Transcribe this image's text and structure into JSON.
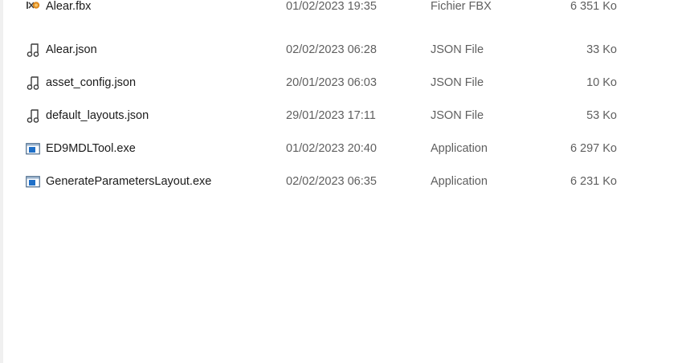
{
  "files": [
    {
      "name": "Alear.fbx",
      "date": "01/02/2023 19:35",
      "type": "Fichier FBX",
      "size": "6 351 Ko",
      "icon": "fbx-file-icon"
    },
    {
      "name": "Alear.json",
      "date": "02/02/2023 06:28",
      "type": "JSON File",
      "size": "33 Ko",
      "icon": "json-file-icon"
    },
    {
      "name": "asset_config.json",
      "date": "20/01/2023 06:03",
      "type": "JSON File",
      "size": "10 Ko",
      "icon": "json-file-icon"
    },
    {
      "name": "default_layouts.json",
      "date": "29/01/2023 17:11",
      "type": "JSON File",
      "size": "53 Ko",
      "icon": "json-file-icon"
    },
    {
      "name": "ED9MDLTool.exe",
      "date": "01/02/2023 20:40",
      "type": "Application",
      "size": "6 297 Ko",
      "icon": "application-icon"
    },
    {
      "name": "GenerateParametersLayout.exe",
      "date": "02/02/2023 06:35",
      "type": "Application",
      "size": "6 231 Ko",
      "icon": "application-icon"
    }
  ],
  "colors": {
    "text_primary": "#1b1b1b",
    "text_secondary": "#5f5f5f",
    "app_icon_blue": "#1e6fc8"
  }
}
